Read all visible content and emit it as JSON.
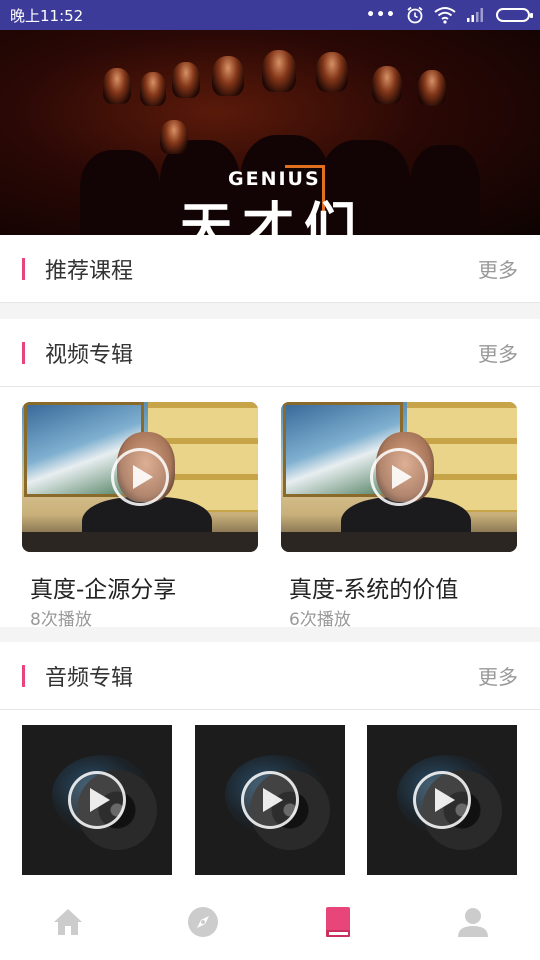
{
  "status_bar": {
    "time": "晚上11:52",
    "icons": [
      "more-dots-icon",
      "alarm-icon",
      "wifi-icon",
      "signal-icon",
      "battery-icon"
    ]
  },
  "banner": {
    "subtitle": "GENIUS",
    "title": "天才们"
  },
  "sections": {
    "recommended": {
      "title": "推荐课程",
      "more": "更多"
    },
    "video": {
      "title": "视频专辑",
      "more": "更多",
      "items": [
        {
          "title": "真度-企源分享",
          "plays": "8次播放"
        },
        {
          "title": "真度-系统的价值",
          "plays": "6次播放"
        }
      ]
    },
    "audio": {
      "title": "音频专辑",
      "more": "更多",
      "items": [
        {
          "icon": "play-icon"
        },
        {
          "icon": "play-icon"
        },
        {
          "icon": "play-icon"
        }
      ]
    }
  },
  "bottom_nav": {
    "items": [
      {
        "icon": "home-icon",
        "active": false
      },
      {
        "icon": "compass-icon",
        "active": false
      },
      {
        "icon": "book-icon",
        "active": true
      },
      {
        "icon": "user-icon",
        "active": false
      }
    ]
  },
  "colors": {
    "accent": "#e8457a",
    "status_bar": "#3d3b9a",
    "nav_inactive": "#cccccc",
    "text_primary": "#222222",
    "text_secondary": "#999999"
  }
}
